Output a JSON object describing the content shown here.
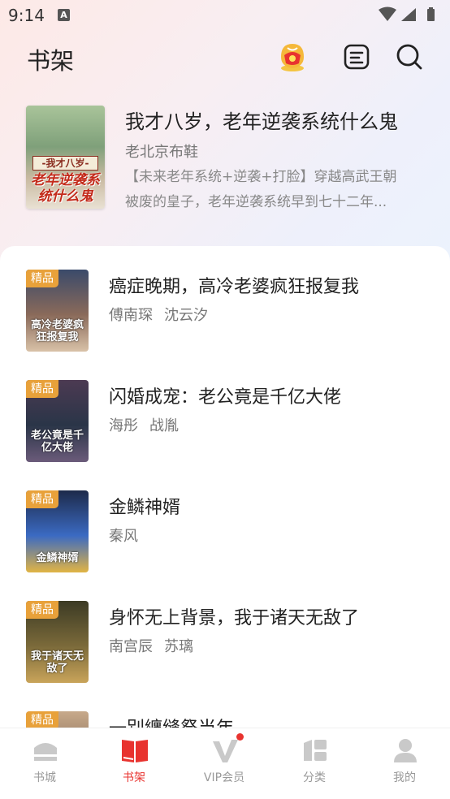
{
  "status_bar": {
    "time": "9:14",
    "notification_icon": "A"
  },
  "header": {
    "title": "书架",
    "icons": [
      "gift-icon",
      "list-icon",
      "search-icon"
    ]
  },
  "featured": {
    "title": "我才八岁，老年逆袭系统什么鬼",
    "author": "老北京布鞋",
    "description_lines": [
      "【未来老年系统+逆袭+打脸】穿越高武王朝",
      "被废的皇子，老年逆袭系统早到七十二年..."
    ],
    "cover_text_top": "-我才八岁-",
    "cover_text_main": "老年逆袭系统什么鬼"
  },
  "books": [
    {
      "badge": "精品",
      "title": "癌症晚期，高冷老婆疯狂报复我",
      "authors": [
        "傅南琛",
        "沈云汐"
      ],
      "cover_text": "高冷老婆疯狂报复我",
      "cover_colors": [
        "#3a4a6a",
        "#8a6a5a",
        "#d9c2a8"
      ]
    },
    {
      "badge": "精品",
      "title": "闪婚成宠：老公竟是千亿大佬",
      "authors": [
        "海彤",
        "战胤"
      ],
      "cover_text": "老公竟是千亿大佬",
      "cover_colors": [
        "#4c3a52",
        "#2a3548",
        "#6b5b7a"
      ]
    },
    {
      "badge": "精品",
      "title": "金鳞神婿",
      "authors": [
        "秦风"
      ],
      "cover_text": "金鳞神婿",
      "cover_colors": [
        "#1d2a4a",
        "#3b6ac2",
        "#e1b444"
      ]
    },
    {
      "badge": "精品",
      "title": "身怀无上背景，我于诸天无敌了",
      "authors": [
        "南宫辰",
        "苏璃"
      ],
      "cover_text": "我于诸天无敌了",
      "cover_colors": [
        "#3b3a24",
        "#7b6a3a",
        "#c9a45a"
      ]
    },
    {
      "badge": "精品",
      "title": "一别纏缝祭当年",
      "authors": [],
      "cover_text": "",
      "cover_colors": [
        "#c7a98a",
        "#8a6f5a",
        "#e8d6c2"
      ]
    }
  ],
  "nav": [
    {
      "label": "书城",
      "icon": "bookstore-icon",
      "active": false
    },
    {
      "label": "书架",
      "icon": "bookshelf-icon",
      "active": true
    },
    {
      "label": "VIP会员",
      "icon": "vip-icon",
      "active": false
    },
    {
      "label": "分类",
      "icon": "category-icon",
      "active": false
    },
    {
      "label": "我的",
      "icon": "profile-icon",
      "active": false
    }
  ],
  "colors": {
    "accent": "#e8332f",
    "badge": "#e8a13a",
    "muted": "#999999"
  }
}
